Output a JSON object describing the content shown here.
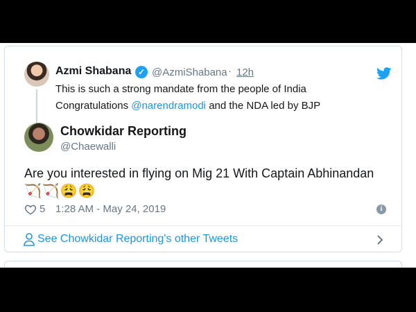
{
  "quoted_tweet": {
    "display_name": "Azmi Shabana",
    "handle": "@AzmiShabana",
    "separator": "·",
    "time_ago": "12h",
    "text_line1": "This is such a strong mandate from the people of India",
    "text_line2_prefix": "Congratulations ",
    "text_line2_mention": "@narendramodi",
    "text_line2_suffix": " and the NDA led by BJP"
  },
  "reply_tweet": {
    "display_name": "Chowkidar Reporting",
    "handle": "@Chaewalli",
    "text": "Are you interested in flying on Mig 21 With Captain Abhinandan",
    "emojis": "🏹🏹😩😩",
    "like_count": "5",
    "timestamp": "1:28 AM - May 24, 2019"
  },
  "footer": {
    "see_more_label": "See Chowkidar Reporting's other Tweets"
  },
  "icons": {
    "verified": "verified-badge-icon",
    "twitter": "twitter-bird-icon",
    "heart": "heart-icon",
    "info": "info-icon",
    "person": "person-icon",
    "chevron": "chevron-right-icon"
  },
  "colors": {
    "accent": "#1da1f2",
    "link": "#1b95e0",
    "muted": "#657786",
    "text": "#14171a"
  }
}
